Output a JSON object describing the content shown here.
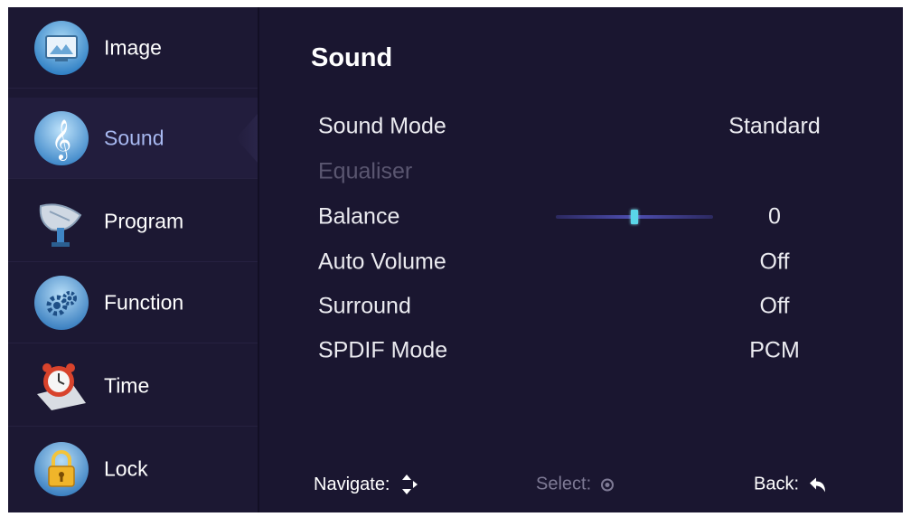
{
  "sidebar": {
    "items": [
      {
        "label": "Image",
        "icon": "image-icon"
      },
      {
        "label": "Sound",
        "icon": "treble-clef-icon",
        "active": true
      },
      {
        "label": "Program",
        "icon": "satellite-dish-icon"
      },
      {
        "label": "Function",
        "icon": "gears-icon"
      },
      {
        "label": "Time",
        "icon": "alarm-clock-icon"
      },
      {
        "label": "Lock",
        "icon": "padlock-icon"
      }
    ]
  },
  "main": {
    "title": "Sound",
    "rows": [
      {
        "label": "Sound Mode",
        "value": "Standard"
      },
      {
        "label": "Equaliser",
        "value": "",
        "disabled": true
      },
      {
        "label": "Balance",
        "value": "0",
        "slider_position": 0.5
      },
      {
        "label": "Auto Volume",
        "value": "Off"
      },
      {
        "label": "Surround",
        "value": "Off"
      },
      {
        "label": "SPDIF Mode",
        "value": "PCM"
      }
    ]
  },
  "footer": {
    "navigate_label": "Navigate:",
    "select_label": "Select:",
    "back_label": "Back:"
  },
  "colors": {
    "background": "#1a1630",
    "sidebar": "#1c1833",
    "active_label": "#a7b8f0",
    "slider_thumb": "#5ad6e8"
  }
}
